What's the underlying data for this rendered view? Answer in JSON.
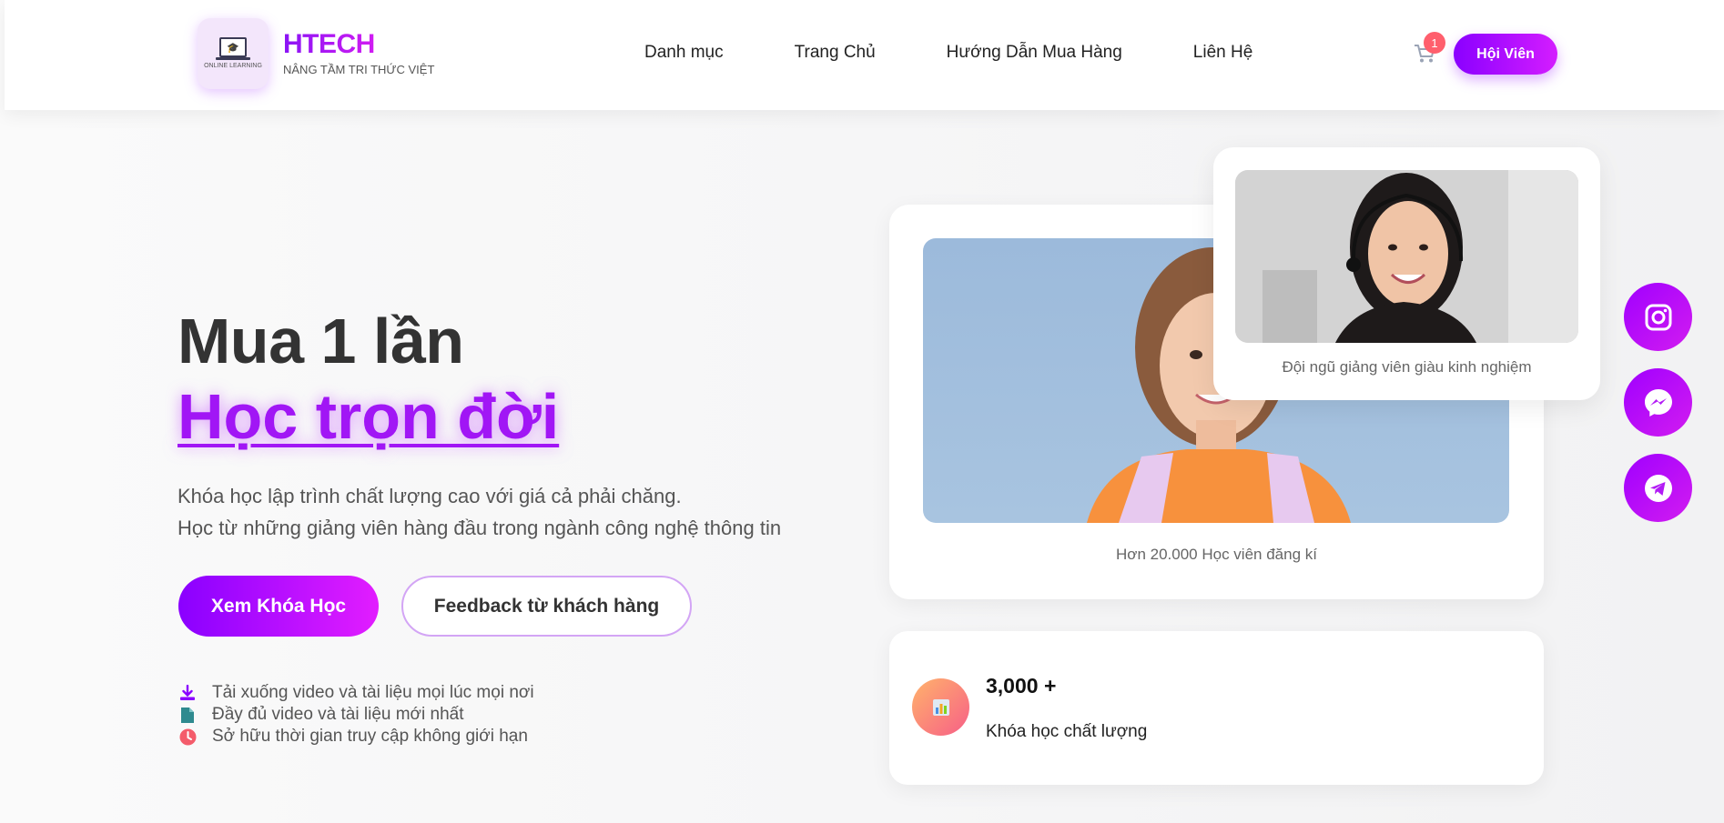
{
  "header": {
    "logo_text": "ONLINE LEARNING",
    "brand_name": "HTECH",
    "tagline": "NÂNG TẦM TRI THỨC VIỆT",
    "nav": [
      "Danh mục",
      "Trang Chủ",
      "Hướng Dẫn Mua Hàng",
      "Liên Hệ"
    ],
    "cart_count": "1",
    "member_button": "Hội Viên"
  },
  "hero": {
    "line1": "Mua 1 lần",
    "line2": "Học trọn đời",
    "desc1": "Khóa học lập trình chất lượng cao với giá cả phải chăng.",
    "desc2": "Học từ những giảng viên hàng đầu trong ngành công nghệ thông tin",
    "primary_button": "Xem Khóa Học",
    "secondary_button": "Feedback từ khách hàng",
    "features": [
      {
        "text": "Tải xuống video và tài liệu mọi lúc mọi nơi",
        "icon": "download-icon",
        "color": "#8a00ff"
      },
      {
        "text": "Đầy đủ video và tài liệu mới nhất",
        "icon": "file-icon",
        "color": "#2f8a8f"
      },
      {
        "text": "Sở hữu thời gian truy cập không giới hạn",
        "icon": "clock-icon",
        "color": "#f45c6b"
      }
    ]
  },
  "cards": {
    "main_caption": "Hơn 20.000 Học viên đăng kí",
    "teacher_caption": "Đội ngũ giảng viên giàu kinh nghiệm",
    "stats_number": "3,000 +",
    "stats_label": "Khóa học chất lượng"
  },
  "social": [
    "instagram-icon",
    "messenger-icon",
    "telegram-icon"
  ],
  "colors": {
    "accent": "#a116f5",
    "accent_gradient_start": "#8a00ff",
    "accent_gradient_end": "#d41dff",
    "badge": "#ff5f6d"
  }
}
